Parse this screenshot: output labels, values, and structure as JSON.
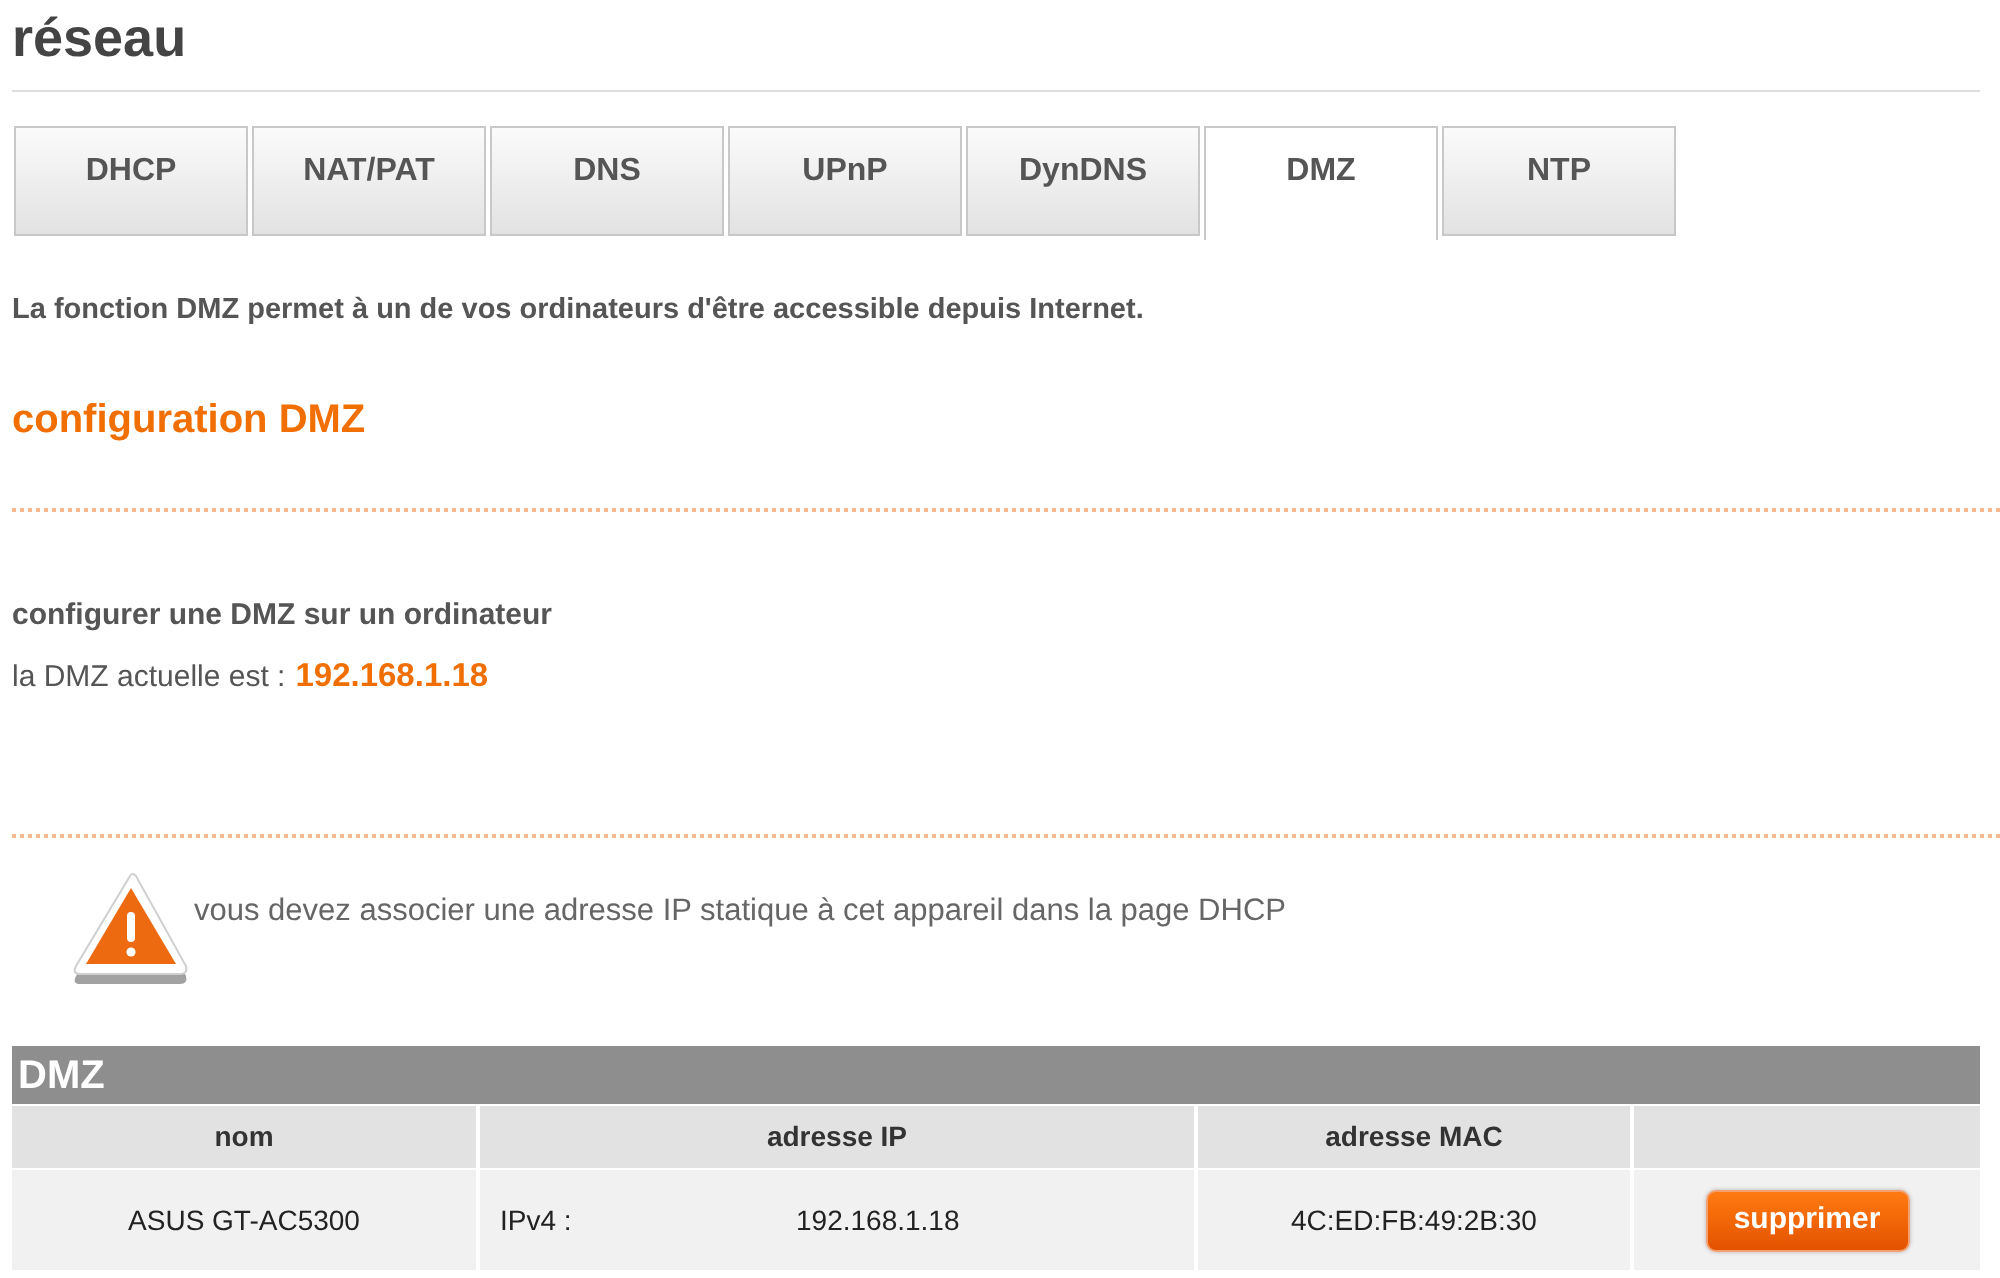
{
  "page": {
    "title": "réseau"
  },
  "tabs": [
    {
      "label": "DHCP",
      "selected": false
    },
    {
      "label": "NAT/PAT",
      "selected": false
    },
    {
      "label": "DNS",
      "selected": false
    },
    {
      "label": "UPnP",
      "selected": false
    },
    {
      "label": "DynDNS",
      "selected": false
    },
    {
      "label": "DMZ",
      "selected": true
    },
    {
      "label": "NTP",
      "selected": false
    }
  ],
  "intro": "La fonction DMZ permet à un de vos ordinateurs d'être accessible depuis Internet.",
  "section": {
    "title": "configuration DMZ",
    "subtitle": "configurer une DMZ sur un ordinateur",
    "current_label": "la DMZ actuelle est :",
    "current_value": "192.168.1.18"
  },
  "warning": {
    "text": "vous devez associer une adresse IP statique à cet appareil dans la page DHCP"
  },
  "table": {
    "title": "DMZ",
    "columns": [
      "nom",
      "adresse IP",
      "adresse MAC"
    ],
    "rows": [
      {
        "name": "ASUS GT-AC5300",
        "ip_version": "IPv4 :",
        "ip": "192.168.1.18",
        "mac": "4C:ED:FB:49:2B:30",
        "action": "supprimer"
      }
    ]
  }
}
